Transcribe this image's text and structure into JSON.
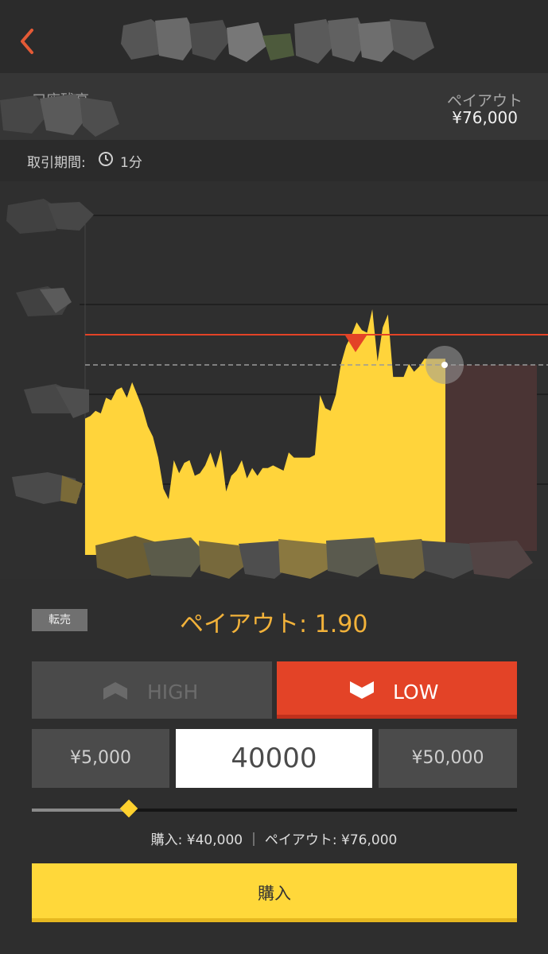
{
  "header": {
    "title_blurred": true
  },
  "account": {
    "balance_label": "口座残高",
    "payout_label": "ペイアウト",
    "payout_value": "¥76,000"
  },
  "trade": {
    "period_label": "取引期間:",
    "period_value": "1分"
  },
  "chart_data": {
    "type": "area",
    "color": "#ffd43b",
    "strike_line_color": "#e34327",
    "values": [
      75.5,
      75.6,
      75.8,
      75.7,
      76.3,
      76.2,
      76.6,
      76.7,
      76.3,
      76.9,
      76.4,
      75.9,
      75.2,
      74.8,
      74.0,
      72.8,
      72.4,
      73.9,
      73.4,
      73.8,
      73.9,
      73.3,
      73.4,
      73.7,
      74.2,
      73.6,
      74.3,
      72.7,
      73.3,
      73.5,
      73.9,
      73.2,
      73.6,
      73.3,
      73.6,
      73.6,
      73.7,
      73.6,
      73.5,
      74.2,
      74.0,
      74.0,
      74.0,
      74.0,
      74.1,
      76.4,
      75.9,
      75.8,
      76.4,
      77.6,
      78.3,
      78.7,
      79.2,
      78.9,
      78.8,
      79.7,
      77.7,
      79.0,
      79.5,
      77.1,
      77.1,
      77.1,
      77.6,
      77.3,
      77.5,
      77.8,
      77.8,
      77.8,
      77.8,
      77.8
    ]
  },
  "panel": {
    "resale_label": "転売",
    "payout_rate_label": "ペイアウト: 1.90",
    "high_label": "HIGH",
    "low_label": "LOW",
    "min_amount": "¥5,000",
    "amount_value": "40000",
    "max_amount": "¥50,000",
    "slider_level": 0.2,
    "summary": "購入: ¥40,000 ｜ ペイアウト: ¥76,000",
    "buy_label": "購入"
  },
  "colors": {
    "accent_yellow": "#ffd83a",
    "low_red": "#e34327",
    "payout_orange": "#f2b23a"
  },
  "icons": {
    "back": "chevron-left-icon",
    "clock": "clock-icon",
    "high": "up-arrow-icon",
    "low": "down-arrow-icon"
  }
}
